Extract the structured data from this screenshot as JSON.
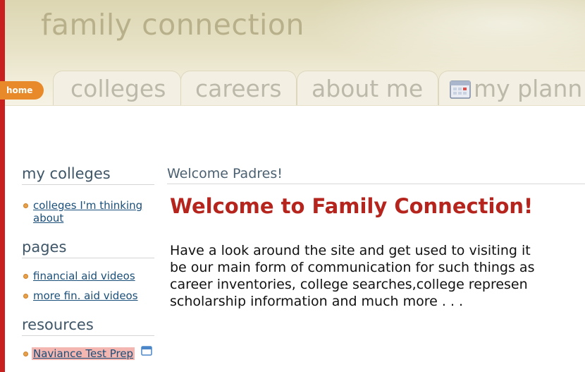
{
  "header": {
    "site_title": "family connection",
    "home_label": "home",
    "tabs": [
      {
        "label": "colleges"
      },
      {
        "label": "careers"
      },
      {
        "label": "about me"
      },
      {
        "label": "my plann",
        "icon": "calendar-icon"
      }
    ]
  },
  "sidebar": {
    "sections": [
      {
        "heading": "my colleges",
        "items": [
          {
            "label": "colleges I'm thinking about"
          }
        ]
      },
      {
        "heading": "pages",
        "items": [
          {
            "label": "financial aid videos"
          },
          {
            "label": "more fin. aid videos"
          }
        ]
      },
      {
        "heading": "resources",
        "items": [
          {
            "label": "Naviance Test Prep",
            "icon": "external-window-icon"
          }
        ]
      }
    ]
  },
  "main": {
    "welcome_heading": "Welcome Padres!",
    "welcome_title": "Welcome to Family Connection!",
    "body_lines": [
      "Have a look around the site and get used to visiting it",
      "be our main form of communication for such things as",
      "career inventories, college searches,college represen",
      "scholarship information  and much more . . ."
    ]
  },
  "colors": {
    "accent_red": "#c8201e",
    "home_orange": "#e88a2a",
    "title_red": "#b5251d",
    "link_blue": "#1a4f7a",
    "highlight_pink": "#f3b6b0"
  }
}
